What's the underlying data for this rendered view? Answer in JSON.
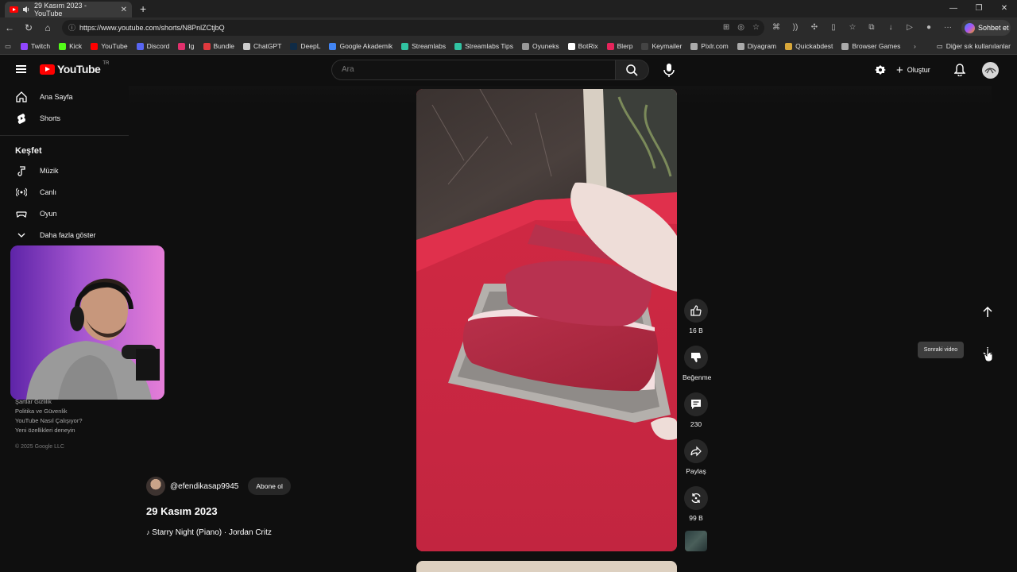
{
  "browser": {
    "tab_title": "29 Kasım 2023 - YouTube",
    "url": "https://www.youtube.com/shorts/N8PnlZCtjbQ",
    "chat_button": "Sohbet et",
    "bookmarks": [
      {
        "label": "Twitch",
        "color": "#9146ff"
      },
      {
        "label": "Kick",
        "color": "#53fc18"
      },
      {
        "label": "YouTube",
        "color": "#ff0000"
      },
      {
        "label": "Discord",
        "color": "#5865f2"
      },
      {
        "label": "Ig",
        "color": "#e1306c"
      },
      {
        "label": "Bundle",
        "color": "#e0393e"
      },
      {
        "label": "ChatGPT",
        "color": "#cccccc"
      },
      {
        "label": "DeepL",
        "color": "#0f2b46"
      },
      {
        "label": "Google Akademik",
        "color": "#4285f4"
      },
      {
        "label": "Streamlabs",
        "color": "#31c3a2"
      },
      {
        "label": "Streamlabs Tips",
        "color": "#31c3a2"
      },
      {
        "label": "Oyuneks",
        "color": "#999999"
      },
      {
        "label": "BotRix",
        "color": "#ffffff"
      },
      {
        "label": "Blerp",
        "color": "#e6245b"
      },
      {
        "label": "Keymailer",
        "color": "#444444"
      },
      {
        "label": "Pixlr.com",
        "color": "#aaaaaa"
      },
      {
        "label": "Diyagram",
        "color": "#aaaaaa"
      },
      {
        "label": "Quickabdest",
        "color": "#d8a73a"
      },
      {
        "label": "Browser Games",
        "color": "#aaaaaa"
      }
    ],
    "other_bookmarks": "Diğer sık kullanılanlar"
  },
  "header": {
    "logo_text": "YouTube",
    "logo_region": "TR",
    "search_placeholder": "Ara",
    "create_label": "Oluştur"
  },
  "sidebar": {
    "items": [
      {
        "label": "Ana Sayfa",
        "icon": "home-icon"
      },
      {
        "label": "Shorts",
        "icon": "shorts-icon"
      }
    ],
    "explore_heading": "Keşfet",
    "explore_items": [
      {
        "label": "Müzik",
        "icon": "music-note-icon"
      },
      {
        "label": "Canlı",
        "icon": "live-icon"
      },
      {
        "label": "Oyun",
        "icon": "gaming-icon"
      },
      {
        "label": "Daha fazla göster",
        "icon": "chevron-down-icon"
      }
    ],
    "footer_links": [
      "Şartlar  Gizlilik",
      "Politika ve Güvenlik",
      "YouTube Nasıl Çalışıyor?",
      "Yeni özellikleri deneyin"
    ],
    "copyright": "© 2025 Google LLC"
  },
  "short": {
    "channel": "@efendikasap9945",
    "subscribe_label": "Abone ol",
    "title": "29 Kasım 2023",
    "music": "Starry Night (Piano) · Jordan Critz",
    "likes": "16 B",
    "dislike_label": "Beğenme",
    "comments": "230",
    "share_label": "Paylaş",
    "remix": "99 B"
  },
  "nav": {
    "tooltip": "Sonraki video"
  }
}
